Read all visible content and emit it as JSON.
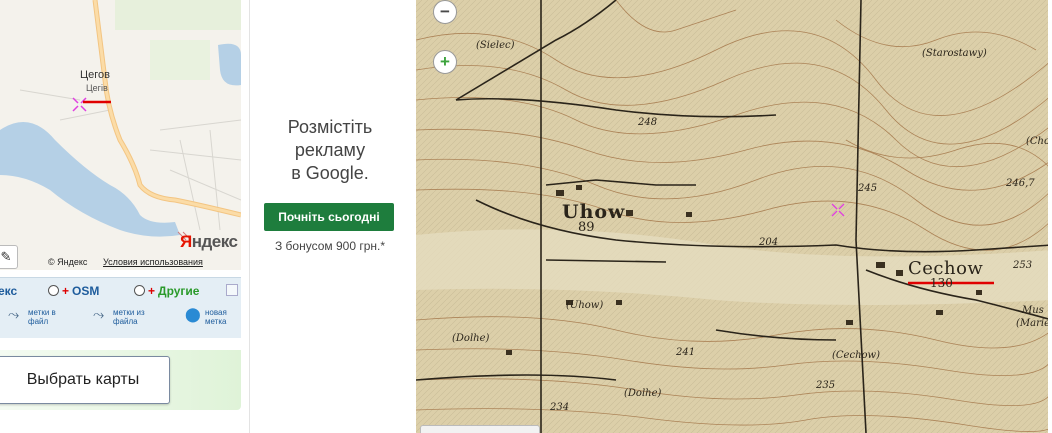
{
  "left_map": {
    "town_name": "Цегов",
    "town_name_sub": "Цегів",
    "copyright": "© Яндекс",
    "terms_link": "Условия использования",
    "logo_letter": "Я",
    "logo_rest": "ндекс",
    "pencil_icon": "✎"
  },
  "layers": {
    "yandex_label": "екс",
    "osm_label": "OSM",
    "other_label": "Другие",
    "plus_symbol": "+",
    "tools": [
      {
        "label": "метки в файл",
        "icon": "import-icon"
      },
      {
        "label": "метки из файла",
        "icon": "export-icon"
      },
      {
        "label": "новая метка",
        "icon": "new-marker-icon"
      }
    ]
  },
  "select_maps_button": "Выбрать карты",
  "ad": {
    "text_line1": "Розмістіть",
    "text_line2": "рекламу",
    "text_line3": "в Google.",
    "button": "Почніть сьогодні",
    "bonus": "З бонусом 900 грн.*"
  },
  "old_map": {
    "zoom_out": "−",
    "zoom_in": "+",
    "labels": {
      "uhow": "Uhow",
      "uhow_elev": "89",
      "cechow": "Cechow",
      "cechow_elev": "130",
      "sielec": "(Sielec)",
      "starostawy": "(Starostawy)",
      "uhow_small": "(Uhow)",
      "dolhe1": "(Dolhe)",
      "dolhe2": "(Dolhe)",
      "cechow_small": "(Cechow)",
      "mus": "Mus",
      "marie": "(Marie",
      "cho": "(Cho",
      "e248": "248",
      "e241": "241",
      "e235": "235",
      "e234": "234",
      "e2467": "246,7",
      "e253": "253",
      "e204": "204",
      "e245": "245"
    }
  },
  "colors": {
    "ad_button": "#1e7d3d",
    "marker_red": "#e00000",
    "link_blue": "#1e5c9c",
    "other_green": "#2a9a2a"
  }
}
